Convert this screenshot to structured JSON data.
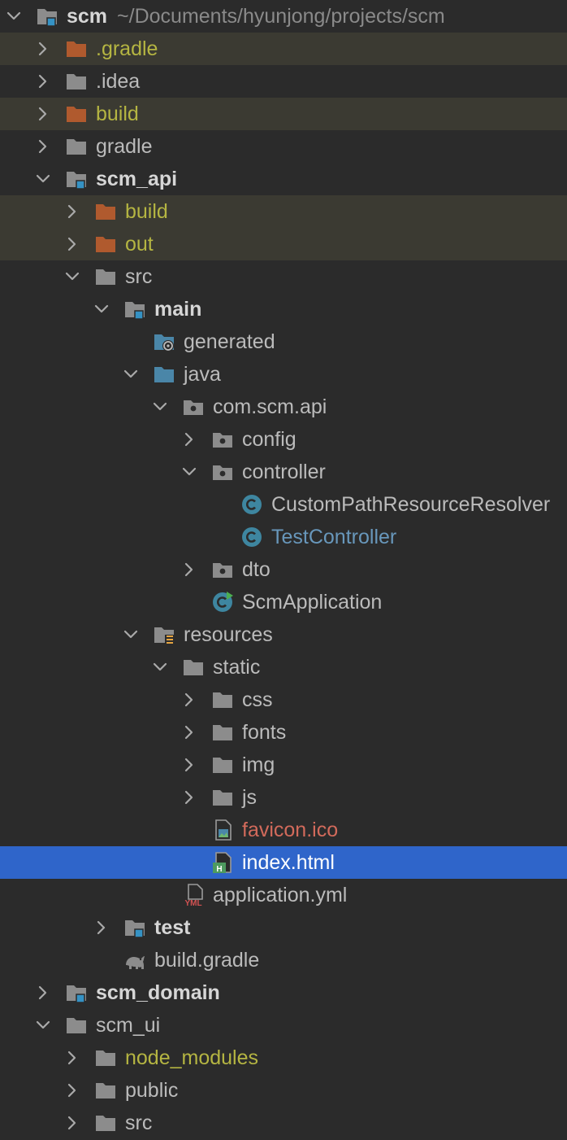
{
  "project_tree": {
    "nodes": [
      {
        "label": "scm",
        "path": "~/Documents/hyunjong/projects/scm",
        "depth": 0,
        "chevron": "open",
        "icon": "module-folder-icon",
        "style": "bold"
      },
      {
        "label": ".gradle",
        "depth": 1,
        "chevron": "closed",
        "icon": "excluded-folder-icon",
        "style": "excluded"
      },
      {
        "label": ".idea",
        "depth": 1,
        "chevron": "closed",
        "icon": "folder-icon",
        "style": "normal"
      },
      {
        "label": "build",
        "depth": 1,
        "chevron": "closed",
        "icon": "excluded-folder-icon",
        "style": "excluded"
      },
      {
        "label": "gradle",
        "depth": 1,
        "chevron": "closed",
        "icon": "folder-icon",
        "style": "normal"
      },
      {
        "label": "scm_api",
        "depth": 1,
        "chevron": "open",
        "icon": "module-folder-icon",
        "style": "bold"
      },
      {
        "label": "build",
        "depth": 2,
        "chevron": "closed",
        "icon": "excluded-folder-icon",
        "style": "excluded"
      },
      {
        "label": "out",
        "depth": 2,
        "chevron": "closed",
        "icon": "excluded-folder-icon",
        "style": "excluded"
      },
      {
        "label": "src",
        "depth": 2,
        "chevron": "open",
        "icon": "folder-icon",
        "style": "normal"
      },
      {
        "label": "main",
        "depth": 3,
        "chevron": "open",
        "icon": "module-folder-icon",
        "style": "bold"
      },
      {
        "label": "generated",
        "depth": 4,
        "chevron": "none",
        "icon": "generated-folder-icon",
        "style": "normal"
      },
      {
        "label": "java",
        "depth": 4,
        "chevron": "open",
        "icon": "source-folder-icon",
        "style": "normal"
      },
      {
        "label": "com.scm.api",
        "depth": 5,
        "chevron": "open",
        "icon": "package-icon",
        "style": "normal"
      },
      {
        "label": "config",
        "depth": 6,
        "chevron": "closed",
        "icon": "package-icon",
        "style": "normal"
      },
      {
        "label": "controller",
        "depth": 6,
        "chevron": "open",
        "icon": "package-icon",
        "style": "normal"
      },
      {
        "label": "CustomPathResourceResolver",
        "depth": 7,
        "chevron": "none",
        "icon": "java-class-icon",
        "style": "normal"
      },
      {
        "label": "TestController",
        "depth": 7,
        "chevron": "none",
        "icon": "java-class-icon",
        "style": "modified"
      },
      {
        "label": "dto",
        "depth": 6,
        "chevron": "closed",
        "icon": "package-icon",
        "style": "normal"
      },
      {
        "label": "ScmApplication",
        "depth": 6,
        "chevron": "none",
        "icon": "spring-boot-class-icon",
        "style": "normal"
      },
      {
        "label": "resources",
        "depth": 4,
        "chevron": "open",
        "icon": "resources-folder-icon",
        "style": "normal"
      },
      {
        "label": "static",
        "depth": 5,
        "chevron": "open",
        "icon": "folder-icon",
        "style": "normal"
      },
      {
        "label": "css",
        "depth": 6,
        "chevron": "closed",
        "icon": "folder-icon",
        "style": "normal"
      },
      {
        "label": "fonts",
        "depth": 6,
        "chevron": "closed",
        "icon": "folder-icon",
        "style": "normal"
      },
      {
        "label": "img",
        "depth": 6,
        "chevron": "closed",
        "icon": "folder-icon",
        "style": "normal"
      },
      {
        "label": "js",
        "depth": 6,
        "chevron": "closed",
        "icon": "folder-icon",
        "style": "normal"
      },
      {
        "label": "favicon.ico",
        "depth": 6,
        "chevron": "none",
        "icon": "image-file-icon",
        "style": "unversioned"
      },
      {
        "label": "index.html",
        "depth": 6,
        "chevron": "none",
        "icon": "html-file-icon",
        "style": "selected"
      },
      {
        "label": "application.yml",
        "depth": 5,
        "chevron": "none",
        "icon": "yaml-file-icon",
        "style": "normal"
      },
      {
        "label": "test",
        "depth": 3,
        "chevron": "closed",
        "icon": "module-folder-icon",
        "style": "bold"
      },
      {
        "label": "build.gradle",
        "depth": 3,
        "chevron": "none",
        "icon": "gradle-file-icon",
        "style": "normal"
      },
      {
        "label": "scm_domain",
        "depth": 1,
        "chevron": "closed",
        "icon": "module-folder-icon",
        "style": "bold"
      },
      {
        "label": "scm_ui",
        "depth": 1,
        "chevron": "open",
        "icon": "folder-icon",
        "style": "normal"
      },
      {
        "label": "node_modules",
        "depth": 2,
        "chevron": "closed",
        "icon": "folder-icon",
        "style": "excluded-label"
      },
      {
        "label": "public",
        "depth": 2,
        "chevron": "closed",
        "icon": "folder-icon",
        "style": "normal"
      },
      {
        "label": "src",
        "depth": 2,
        "chevron": "closed",
        "icon": "folder-icon",
        "style": "normal"
      }
    ]
  },
  "colors": {
    "background": "#2b2b2b",
    "excluded_row": "#3b3a32",
    "selected_row": "#2f65ca",
    "excluded_text": "#b5b542",
    "modified_text": "#6897bb",
    "unversioned_text": "#d26a5b",
    "folder": "#8c8c8c",
    "excluded_folder": "#b05a2e",
    "source_folder": "#4a86a8",
    "class_icon": "#3e86a0",
    "module_marker": "#3592c4"
  }
}
